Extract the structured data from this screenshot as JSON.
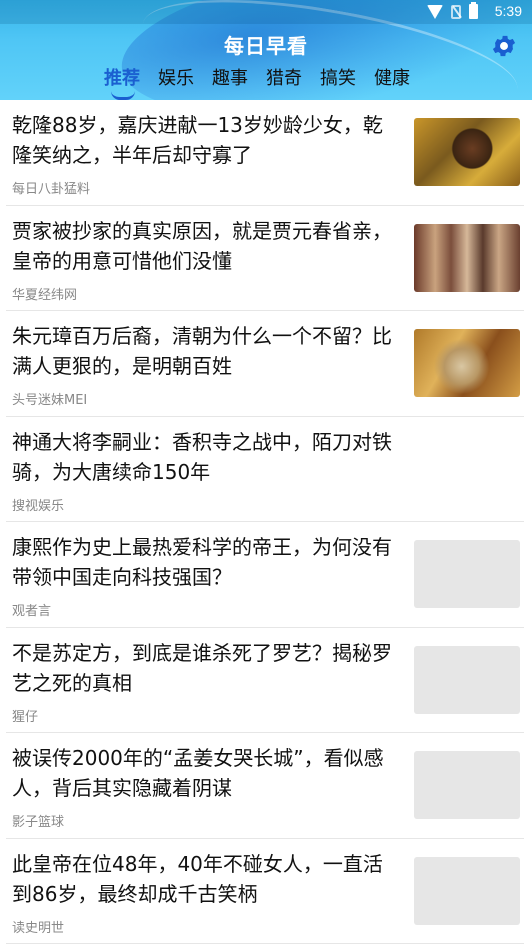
{
  "status_bar": {
    "time": "5:39"
  },
  "header": {
    "title": "每日早看",
    "settings_icon": "gear-icon"
  },
  "tabs": [
    {
      "label": "推荐",
      "active": true
    },
    {
      "label": "娱乐"
    },
    {
      "label": "趣事"
    },
    {
      "label": "猎奇"
    },
    {
      "label": "搞笑"
    },
    {
      "label": "健康"
    }
  ],
  "feed": [
    {
      "title": "乾隆88岁，嘉庆进献一13岁妙龄少女，乾隆笑纳之，半年后却守寡了",
      "source": "每日八卦猛料",
      "thumbnail": "photo"
    },
    {
      "title": "贾家被抄家的真实原因，就是贾元春省亲，皇帝的用意可惜他们没懂",
      "source": "华夏经纬网",
      "thumbnail": "photo"
    },
    {
      "title": "朱元璋百万后裔，清朝为什么一个不留？比满人更狠的，是明朝百姓",
      "source": "头号迷妹MEI",
      "thumbnail": "photo"
    },
    {
      "title": "神通大将李嗣业：香积寺之战中，陌刀对铁骑，为大唐续命150年",
      "source": "搜视娱乐",
      "thumbnail": "none"
    },
    {
      "title": "康熙作为史上最热爱科学的帝王，为何没有带领中国走向科技强国？",
      "source": "观者言",
      "thumbnail": "placeholder"
    },
    {
      "title": "不是苏定方，到底是谁杀死了罗艺？揭秘罗艺之死的真相",
      "source": "猩仔",
      "thumbnail": "placeholder"
    },
    {
      "title": "被误传2000年的“孟姜女哭长城”，看似感人，背后其实隐藏着阴谋",
      "source": "影子篮球",
      "thumbnail": "placeholder"
    },
    {
      "title": "此皇帝在位48年，40年不碰女人，一直活到86岁，最终却成千古笑柄",
      "source": "读史明世",
      "thumbnail": "placeholder"
    }
  ]
}
